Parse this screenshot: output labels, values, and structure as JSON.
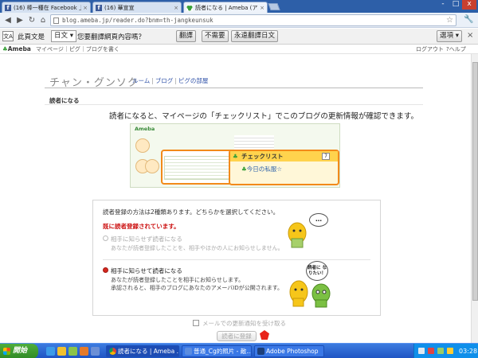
{
  "browser": {
    "tabs": [
      {
        "label": "(16) 棒一種在 Facebook 上",
        "icon": "facebook-icon"
      },
      {
        "label": "(16) 華宣宣",
        "icon": "facebook-icon"
      },
      {
        "label": "読者になる | Ameba (アメ",
        "icon": "ameba-leaf-icon"
      }
    ],
    "url": "blog.ameba.jp/reader.do?bnm=th-jangkeunsuk",
    "window_controls": [
      "-",
      "□",
      "x"
    ]
  },
  "translate_bar": {
    "label": "此頁文是",
    "language": "日文",
    "question": "您要翻譯網頁內容嗎？",
    "translate_button": "翻譯",
    "nope_button": "不需要",
    "always_button": "永遠翻譯日文",
    "options_button": "選項"
  },
  "ameba_header": {
    "logo": "Ameba",
    "links": "マイページ｜ピグ｜ブログを書く",
    "logout": "ログアウト",
    "help": "ヘルプ"
  },
  "page": {
    "blog_title": "チャン・グンソク",
    "nav": [
      "ルーム",
      "ブログ",
      "ピグの部屋"
    ],
    "section_title": "読者になる",
    "intro": "読者になると、マイページの「チェックリスト」でこのブログの更新情報が確認できます。",
    "preview": {
      "logo": "Ameba",
      "checklist_title": "チェックリスト",
      "badge": "7",
      "item": "今日の私服"
    },
    "box": {
      "methods_text": "読者登録の方法は2種類あります。どちらかを選択してください。",
      "already_registered": "既に読者登録されています。",
      "option1_label": "相手に知らせず読者になる",
      "option1_desc": "あなたが読者登録したことを、相手やほかの人にお知らせしません。",
      "option2_label": "相手に知らせて読者になる",
      "option2_desc_1": "あなたが読者登録したことを相手にお知らせします。",
      "option2_desc_2": "承認されると、相手のブログにあなたのアメーバIDが公開されます。",
      "bubble1": "…",
      "bubble2": "読者に なりたい！"
    },
    "mail_option": "メールでの更新通知を受け取る",
    "register_button": "読者に登録"
  },
  "taskbar": {
    "start": "開始",
    "tasks": [
      {
        "label": "読者になる | Ameba ..."
      },
      {
        "label": "普通_Cg的照片 - 敵..."
      },
      {
        "label": "Adobe Photoshop"
      }
    ],
    "clock": "03:28"
  },
  "colors": {
    "accent_orange": "#f28a1a",
    "error_red": "#cc1111",
    "ameba_green": "#3aa13a",
    "link_blue": "#3355aa"
  }
}
